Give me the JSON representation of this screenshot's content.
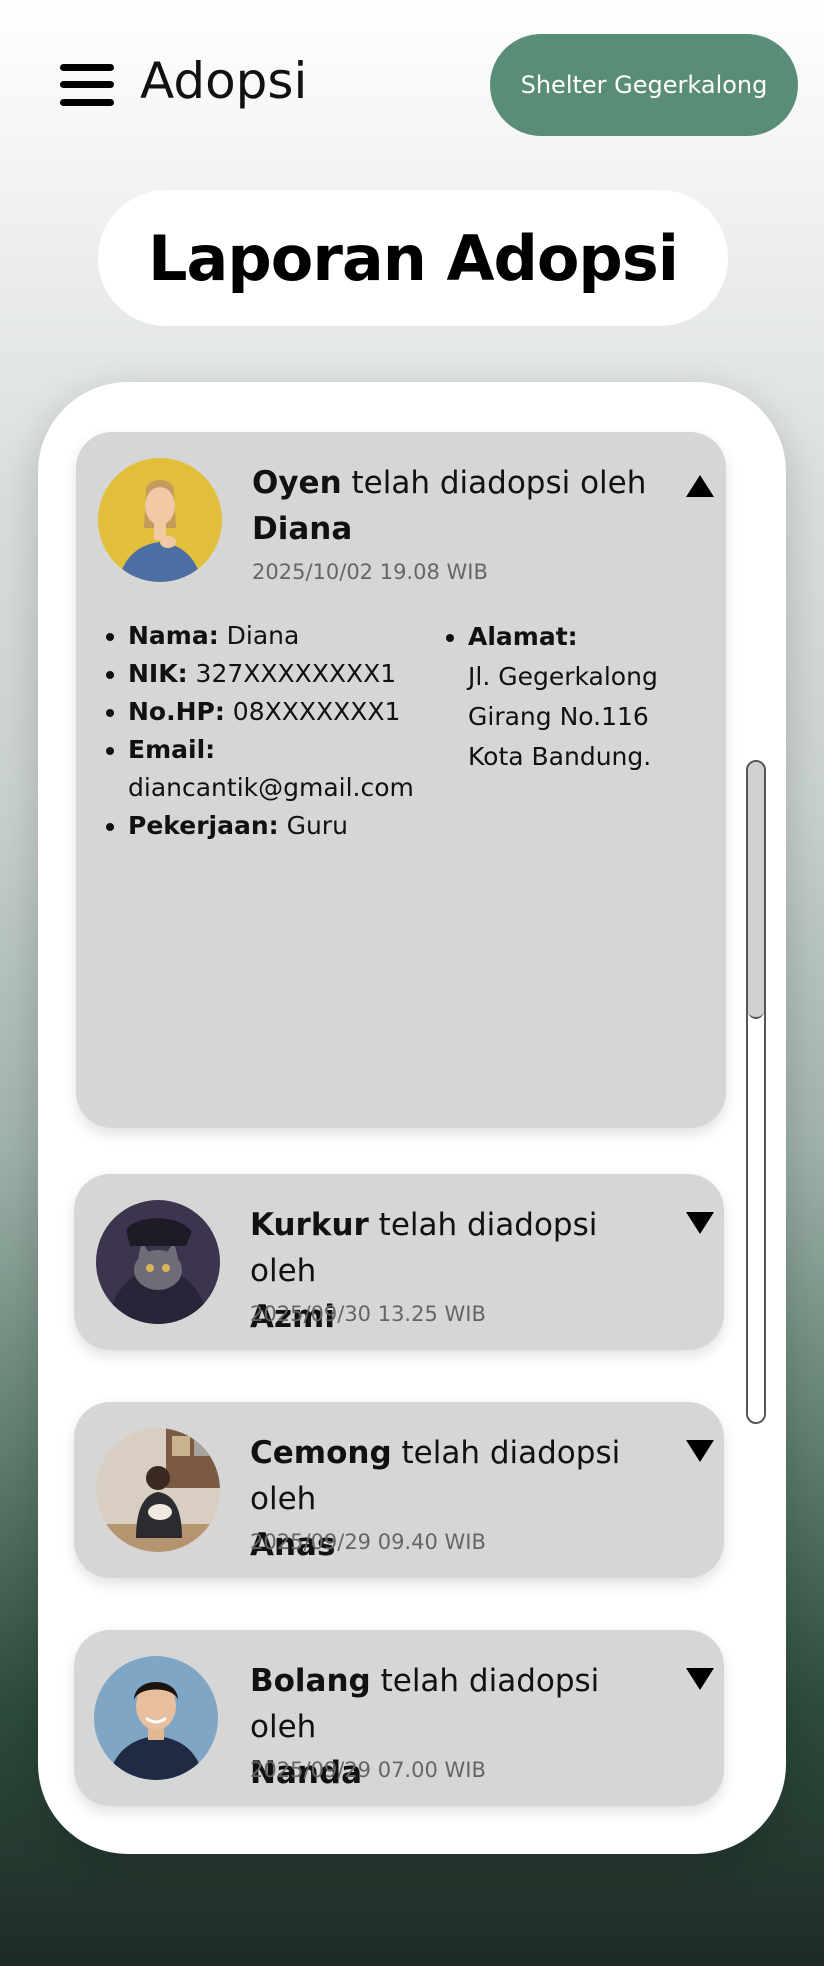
{
  "header": {
    "menu_icon": "hamburger-menu-icon",
    "title": "Adopsi",
    "shelter_button": "Shelter Gegerkalong"
  },
  "page_title": "Laporan Adopsi",
  "colors": {
    "accent": "#5a8d76",
    "card": "#d6d6d6"
  },
  "reports": [
    {
      "pet": "Oyen",
      "connector": " telah diadopsi oleh",
      "adopter": "Diana",
      "date": "2025/10/02 19.08 WIB",
      "expanded": true,
      "details": {
        "nama_label": "Nama:",
        "nama": " Diana",
        "nik_label": "NIK:",
        "nik": " 327XXXXXXXX1",
        "hp_label": "No.HP:",
        "hp": " 08XXXXXXX1",
        "email_label": "Email:",
        "email": "diancantik@gmail.com",
        "pekerjaan_label": "Pekerjaan:",
        "pekerjaan": " Guru",
        "alamat_label": "Alamat:",
        "alamat": "Jl. Gegerkalong Girang No.116 Kota Bandung."
      }
    },
    {
      "pet": "Kurkur",
      "connector": " telah diadopsi oleh",
      "adopter": "Azmi",
      "date": "2025/09/30 13.25 WIB",
      "expanded": false
    },
    {
      "pet": "Cemong",
      "connector": " telah diadopsi oleh",
      "adopter": "Anas",
      "date": "2025/09/29 09.40 WIB",
      "expanded": false
    },
    {
      "pet": "Bolang",
      "connector": " telah diadopsi oleh",
      "adopter": "Nanda",
      "date": "2025/09/29 07.00 WIB",
      "expanded": false
    }
  ]
}
